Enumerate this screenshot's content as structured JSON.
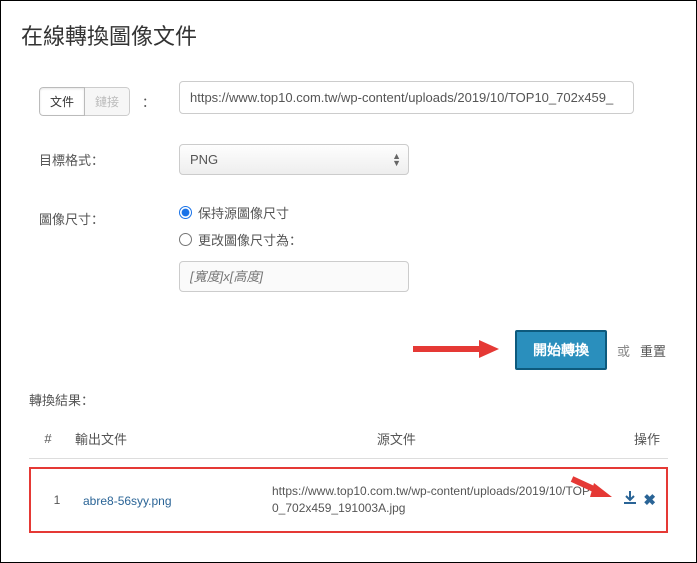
{
  "title": "在線轉換圖像文件",
  "source_toggle": {
    "file": "文件",
    "link": "鏈接",
    "separator": "："
  },
  "url_input": "https://www.top10.com.tw/wp-content/uploads/2019/10/TOP10_702x459_",
  "target_format": {
    "label": "目標格式：",
    "value": "PNG"
  },
  "image_size": {
    "label": "圖像尺寸：",
    "keep": "保持源圖像尺寸",
    "change": "更改圖像尺寸為：",
    "placeholder": "[寬度]x[高度]"
  },
  "actions": {
    "start": "開始轉換",
    "or": "或",
    "reset": "重置"
  },
  "results": {
    "title": "轉換結果：",
    "headers": {
      "idx": "#",
      "output": "輸出文件",
      "source": "源文件",
      "ops": "操作"
    },
    "rows": [
      {
        "idx": "1",
        "output": "abre8-56syy.png",
        "source": "https://www.top10.com.tw/wp-content/uploads/2019/10/TOP10_702x459_191003A.jpg"
      }
    ]
  }
}
